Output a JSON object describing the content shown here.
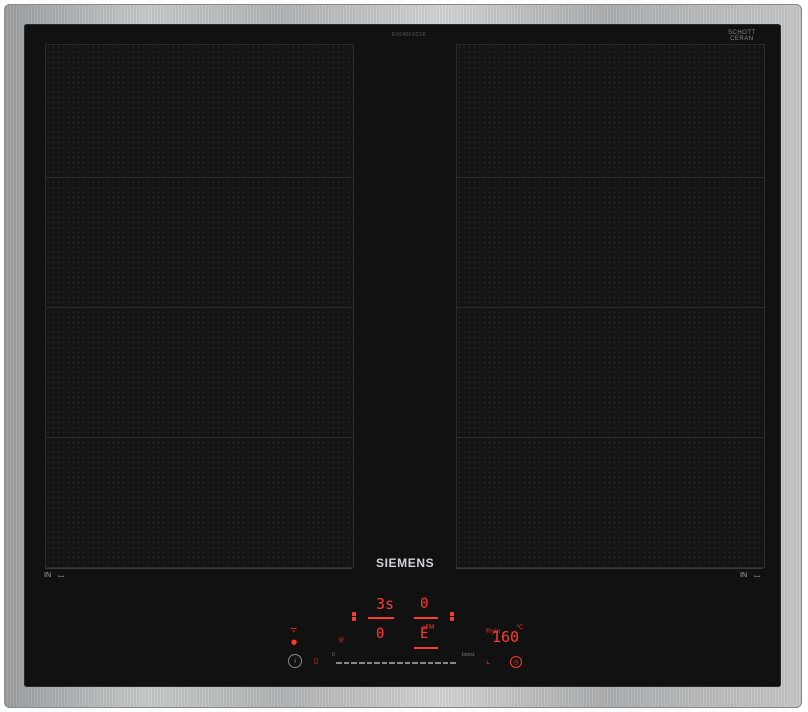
{
  "product": {
    "brand": "SIEMENS",
    "model_code": "EX645FXC1E",
    "glass_brand_line1": "SCHOTT",
    "glass_brand_line2": "CERAN"
  },
  "zones": {
    "left_label": "IN",
    "right_label": "IN"
  },
  "controls": {
    "display_top_left": "3s",
    "display_top_right": "0",
    "display_bottom_left": "0",
    "display_bottom_right": "E",
    "timer_readout": "160",
    "timer_unit": "°C",
    "timer_prefix": "Fryin",
    "slider_start": "0",
    "slider_end": "boost",
    "zone_sub_label": "oFM"
  },
  "icons": {
    "info": "info-icon",
    "power": "power-icon",
    "lock": "lock-icon",
    "fry": "frying-sensor-icon",
    "timer": "timer-icon",
    "wifi": "wifi-icon",
    "light": "sun-icon"
  },
  "colors": {
    "display": "#ff3b2e",
    "glass": "#111112",
    "frame": "#b8bbbd"
  }
}
